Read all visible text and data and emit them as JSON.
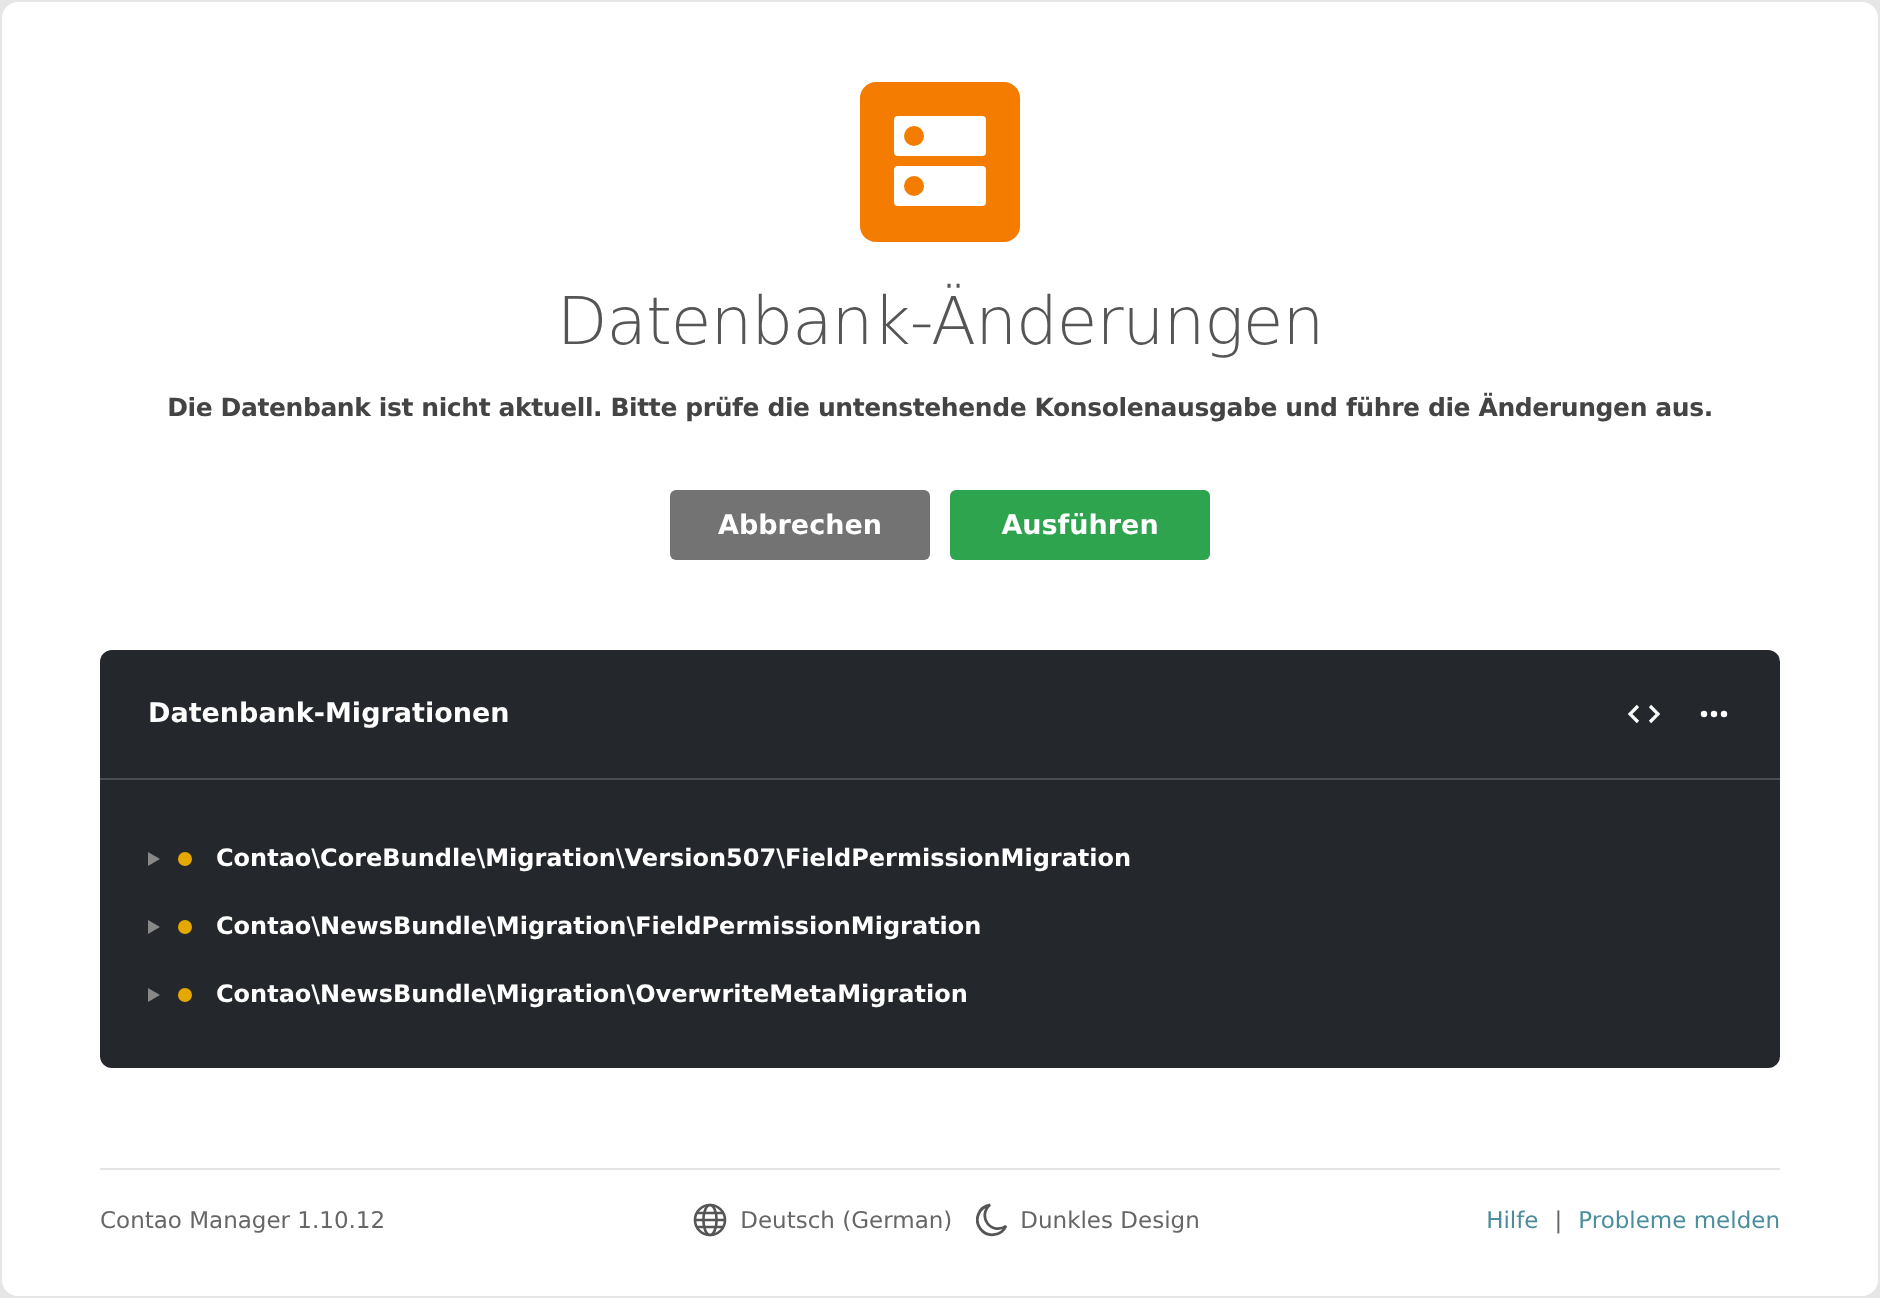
{
  "title": "Datenbank-Änderungen",
  "description": "Die Datenbank ist nicht aktuell. Bitte prüfe die untenstehende Konsolenausgabe und führe die Änderungen aus.",
  "buttons": [
    {
      "label": "Abbrechen",
      "kind": "cancel"
    },
    {
      "label": "Ausführen",
      "kind": "primary"
    }
  ],
  "console": {
    "title": "Datenbank-Migrationen",
    "items": [
      {
        "text": "Contao\\CoreBundle\\Migration\\Version507\\FieldPermissionMigration",
        "color": "#e5a800",
        "expanded": false
      },
      {
        "text": "Contao\\NewsBundle\\Migration\\FieldPermissionMigration",
        "color": "#e5a800",
        "expanded": false
      },
      {
        "text": "Contao\\NewsBundle\\Migration\\OverwriteMetaMigration",
        "color": "#e5a800",
        "expanded": false
      }
    ]
  },
  "footer": {
    "version": "Contao Manager 1.10.12",
    "language": "Deutsch (German)",
    "theme": "Dunkles Design",
    "links": [
      "Hilfe",
      "Probleme melden"
    ],
    "separator": "|"
  }
}
